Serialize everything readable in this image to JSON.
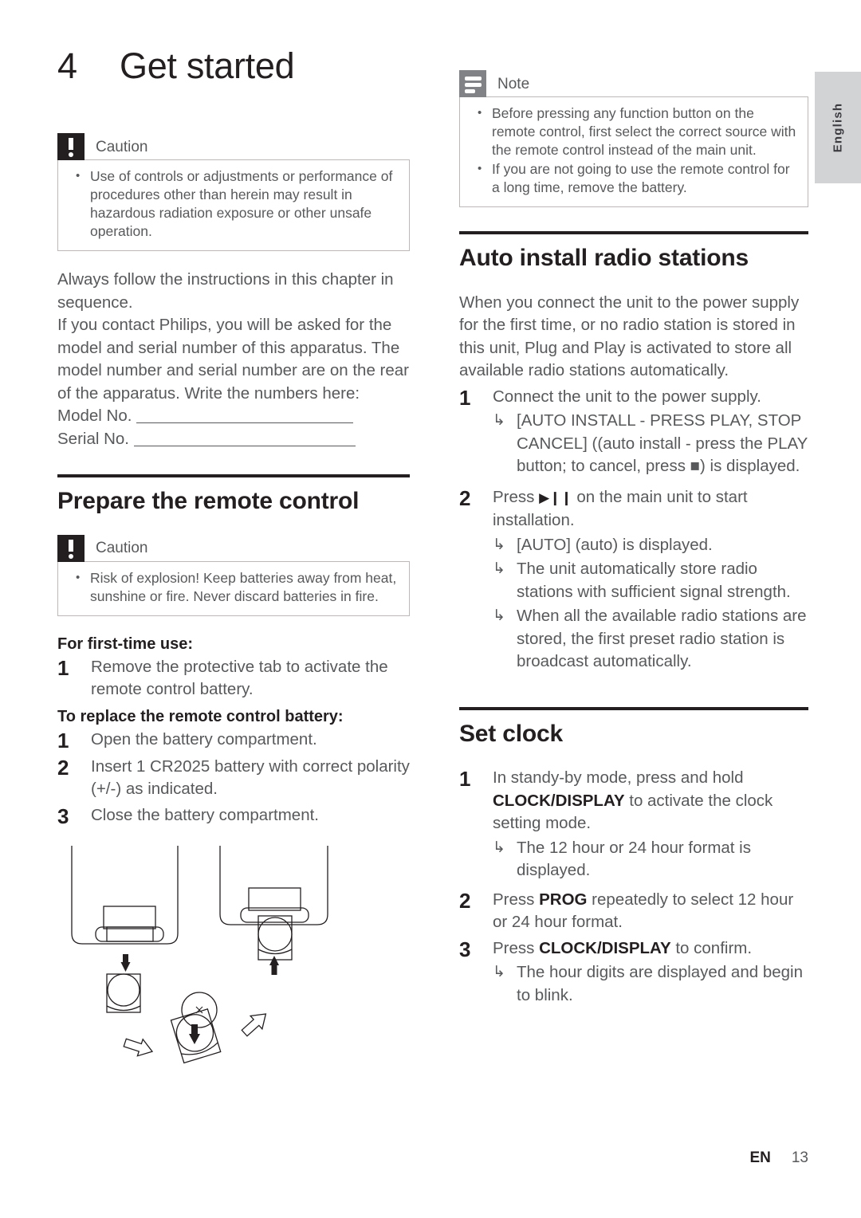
{
  "chapter": {
    "number": "4",
    "title": "Get started"
  },
  "left_column": {
    "caution_1": {
      "icon": "exclamation-icon",
      "label": "Caution",
      "items": [
        "Use of controls or adjustments or performance of procedures other than herein may result in hazardous radiation exposure or other unsafe operation."
      ]
    },
    "intro_paragraph_1": "Always follow the instructions in this chapter in sequence.",
    "intro_paragraph_2": "If you contact Philips, you will be asked for the model and serial number of this apparatus. The model number and serial number are on the rear of the apparatus. Write the numbers here:",
    "model_label": "Model No.",
    "serial_label": "Serial No.",
    "section": {
      "title": "Prepare the remote control"
    },
    "caution_2": {
      "icon": "exclamation-icon",
      "label": "Caution",
      "items": [
        "Risk of explosion! Keep batteries away from heat, sunshine or fire. Never discard batteries in fire."
      ]
    },
    "first_time_heading": "For first-time use:",
    "first_time_steps": [
      {
        "num": "1",
        "text": "Remove the protective tab to activate the remote control battery."
      }
    ],
    "replace_heading": "To replace the remote control battery:",
    "replace_steps": [
      {
        "num": "1",
        "text": "Open the battery compartment."
      },
      {
        "num": "2",
        "text": "Insert 1 CR2025 battery with correct polarity (+/-) as indicated."
      },
      {
        "num": "3",
        "text": "Close the battery compartment."
      }
    ],
    "illustration_name": "remote-control-battery-diagram"
  },
  "right_column": {
    "note": {
      "icon": "note-lines-icon",
      "label": "Note",
      "items": [
        "Before pressing any function button on the remote control, first select the correct source with the remote control instead of the main unit.",
        "If you are not going to use the remote control for a long time, remove the battery."
      ]
    },
    "auto_install": {
      "title": "Auto install radio stations",
      "paragraph": "When you connect the unit to the power supply for the first time, or no radio station is stored in this unit, Plug and Play is activated to store all available radio stations automatically.",
      "steps": [
        {
          "num": "1",
          "text": "Connect the unit to the power supply.",
          "results": [
            "[AUTO INSTALL - PRESS PLAY, STOP CANCEL] ((auto install - press the PLAY button; to cancel, press ■) is displayed."
          ]
        },
        {
          "num": "2",
          "text_before": "Press ",
          "glyph": "▶❙❙",
          "text_after": " on the main unit to start installation.",
          "results": [
            "[AUTO] (auto) is displayed.",
            "The unit automatically store radio stations with sufficient signal strength.",
            "When all the available radio stations are stored, the first preset radio station is broadcast automatically."
          ]
        }
      ]
    },
    "set_clock": {
      "title": "Set clock",
      "steps": [
        {
          "num": "1",
          "text_before": "In standy-by mode, press and hold ",
          "bold": "CLOCK/DISPLAY",
          "text_after": " to activate the clock setting mode.",
          "results": [
            "The 12 hour or 24 hour format is displayed."
          ]
        },
        {
          "num": "2",
          "text_before": "Press ",
          "bold": "PROG",
          "text_after": " repeatedly to select 12 hour or 24 hour format.",
          "results": []
        },
        {
          "num": "3",
          "text_before": "Press ",
          "bold": "CLOCK/DISPLAY",
          "text_after": " to confirm.",
          "results": [
            "The hour digits are displayed and begin to blink."
          ]
        }
      ]
    }
  },
  "language_tab": "English",
  "footer": {
    "language_code": "EN",
    "page_number": "13"
  },
  "colors": {
    "caution_icon_bg": "#231f20",
    "note_icon_bg": "#808285",
    "body_text": "#58595b",
    "heading_text": "#231f20",
    "tab_bg": "#d2d3d5",
    "rule": "#231f20"
  }
}
